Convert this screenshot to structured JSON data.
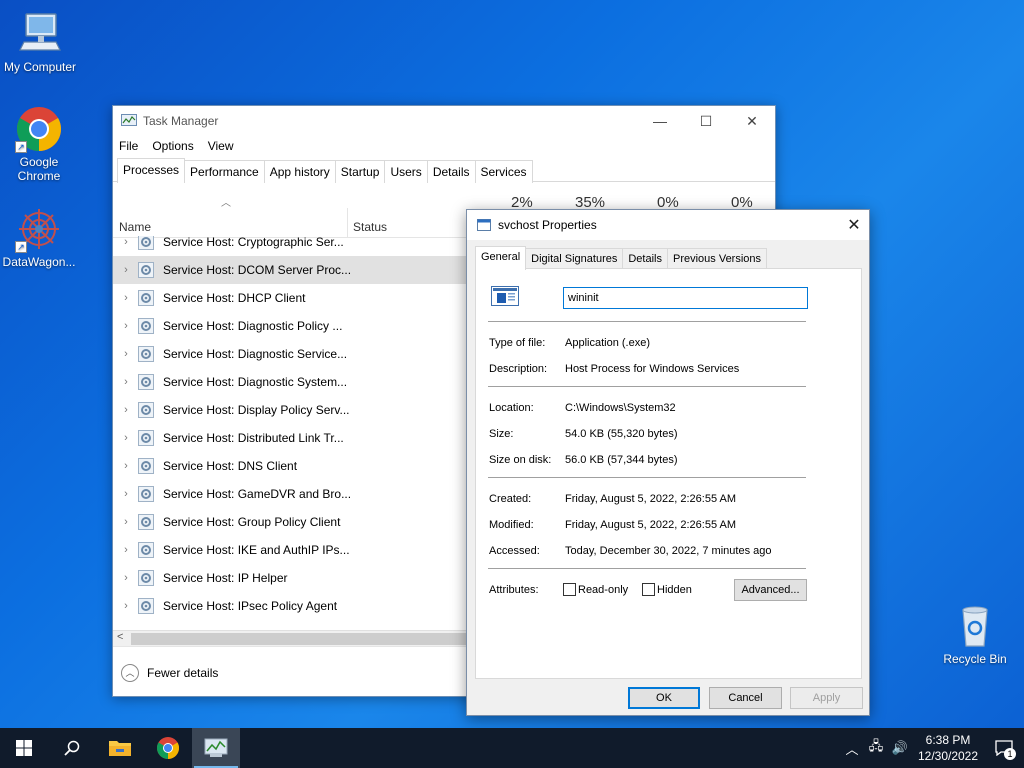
{
  "desktop": {
    "icons": [
      {
        "label": "My Computer"
      },
      {
        "label": "Google Chrome"
      },
      {
        "label": "DataWagon..."
      },
      {
        "label": "Recycle Bin"
      }
    ]
  },
  "task_manager": {
    "title": "Task Manager",
    "menu": [
      "File",
      "Options",
      "View"
    ],
    "tabs": [
      "Processes",
      "Performance",
      "App history",
      "Startup",
      "Users",
      "Details",
      "Services"
    ],
    "active_tab": "Processes",
    "columns": {
      "name": "Name",
      "status": "Status"
    },
    "usage": [
      "2%",
      "35%",
      "0%",
      "0%"
    ],
    "processes": [
      {
        "name": "Service Host: Cryptographic Ser..."
      },
      {
        "name": "Service Host: DCOM Server Proc...",
        "selected": true
      },
      {
        "name": "Service Host: DHCP Client"
      },
      {
        "name": "Service Host: Diagnostic Policy ..."
      },
      {
        "name": "Service Host: Diagnostic Service..."
      },
      {
        "name": "Service Host: Diagnostic System..."
      },
      {
        "name": "Service Host: Display Policy Serv..."
      },
      {
        "name": "Service Host: Distributed Link Tr..."
      },
      {
        "name": "Service Host: DNS Client"
      },
      {
        "name": "Service Host: GameDVR and Bro..."
      },
      {
        "name": "Service Host: Group Policy Client"
      },
      {
        "name": "Service Host: IKE and AuthIP IPs..."
      },
      {
        "name": "Service Host: IP Helper"
      },
      {
        "name": "Service Host: IPsec Policy Agent"
      }
    ],
    "footer": {
      "fewer_details": "Fewer details"
    }
  },
  "properties": {
    "title": "svchost Properties",
    "tabs": [
      "General",
      "Digital Signatures",
      "Details",
      "Previous Versions"
    ],
    "active_tab": "General",
    "name_value": "wininit",
    "type_label": "Type of file:",
    "type_value": "Application (.exe)",
    "desc_label": "Description:",
    "desc_value": "Host Process for Windows Services",
    "loc_label": "Location:",
    "loc_value": "C:\\Windows\\System32",
    "size_label": "Size:",
    "size_value": "54.0 KB (55,320 bytes)",
    "disk_label": "Size on disk:",
    "disk_value": "56.0 KB (57,344 bytes)",
    "created_label": "Created:",
    "created_value": "Friday, August 5, 2022, 2:26:55 AM",
    "modified_label": "Modified:",
    "modified_value": "Friday, August 5, 2022, 2:26:55 AM",
    "accessed_label": "Accessed:",
    "accessed_value": "Today, December 30, 2022, 7 minutes ago",
    "attr_label": "Attributes:",
    "readonly_label": "Read-only",
    "hidden_label": "Hidden",
    "advanced_label": "Advanced...",
    "ok_label": "OK",
    "cancel_label": "Cancel",
    "apply_label": "Apply"
  },
  "taskbar": {
    "time": "6:38 PM",
    "date": "12/30/2022",
    "notification_count": "1"
  }
}
